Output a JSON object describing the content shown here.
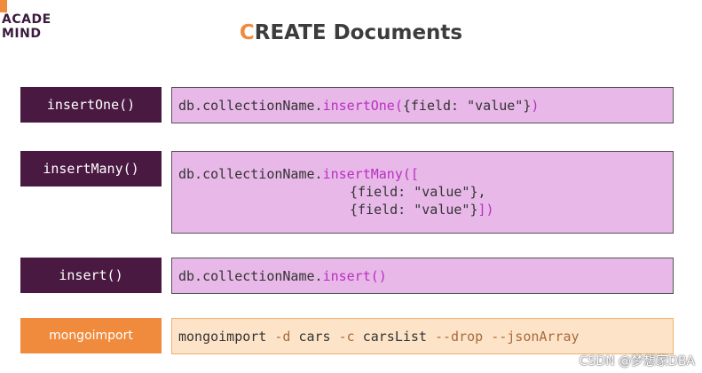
{
  "logo": {
    "line1": "ACADE",
    "line2": "MIND"
  },
  "title": {
    "first_letter": "C",
    "rest": "REATE Documents"
  },
  "rows": [
    {
      "label": "insertOne()",
      "code": {
        "prefix": "db.collectionName.",
        "method": "insertOne(",
        "args": "{field: \"value\"}",
        "close": ")"
      }
    },
    {
      "label": "insertMany()",
      "code": {
        "prefix": "db.collectionName.",
        "method": "insertMany([",
        "arg1": "{field: \"value\"},",
        "arg2": "{field: \"value\"}",
        "close": "])"
      }
    },
    {
      "label": "insert()",
      "code": {
        "prefix": "db.collectionName.",
        "method": "insert()"
      }
    },
    {
      "label": "mongoimport",
      "code": {
        "command": "mongoimport ",
        "d_flag": "-d",
        "db": " cars ",
        "c_flag": "-c",
        "collection": " carsList ",
        "drop_flag": "--drop",
        "space": " ",
        "json_flag": "--jsonArray"
      }
    }
  ],
  "watermark": "CSDN @梦想家DBA",
  "colors": {
    "label_purple": "#4a1942",
    "label_orange": "#f08a3c",
    "code_bg_pink": "#e8b8e8",
    "code_bg_orange": "#fde4c8",
    "method_color": "#b830c0"
  }
}
